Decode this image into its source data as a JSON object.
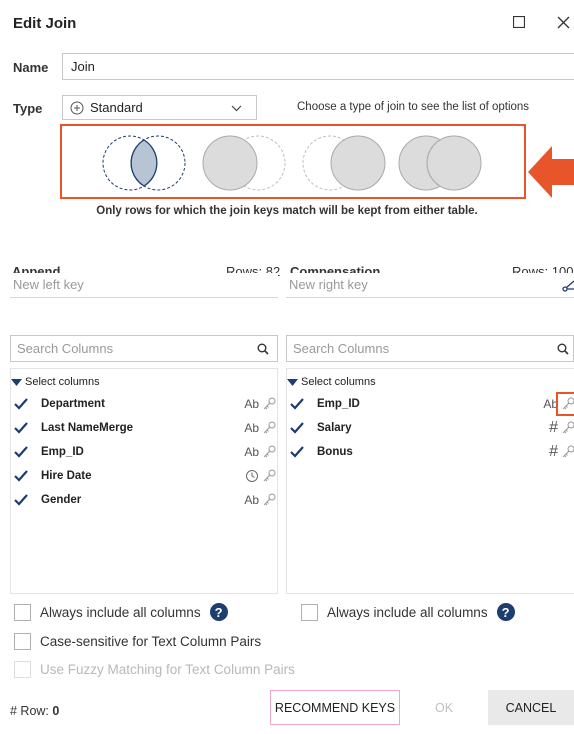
{
  "dialog": {
    "title": "Edit Join"
  },
  "name_field": {
    "label": "Name",
    "value": "Join"
  },
  "type_field": {
    "label": "Type",
    "value": "Standard",
    "hint": "Choose a type of join to see the list of options"
  },
  "join_description": "Only rows for which the join keys match will be kept from either table.",
  "colors": {
    "accent": "#e8552a",
    "check": "#1d3e6e",
    "venn_fill": "#dcdcdc",
    "venn_inner": "#b7c4d3"
  },
  "left": {
    "title": "Append",
    "rows": "Rows: 82",
    "key_placeholder": "New left key",
    "search_placeholder": "Search Columns",
    "select_label": "Select columns",
    "columns": [
      {
        "name": "Department",
        "type": "Ab"
      },
      {
        "name": "Last NameMerge",
        "type": "Ab"
      },
      {
        "name": "Emp_ID",
        "type": "Ab"
      },
      {
        "name": "Hire Date",
        "type": "clock-icon"
      },
      {
        "name": "Gender",
        "type": "Ab"
      }
    ]
  },
  "right": {
    "title": "Compensation",
    "rows": "Rows: 100",
    "key_placeholder": "New right key",
    "search_placeholder": "Search Columns",
    "select_label": "Select columns",
    "columns": [
      {
        "name": "Emp_ID",
        "type": "Ab"
      },
      {
        "name": "Salary",
        "type": "#"
      },
      {
        "name": "Bonus",
        "type": "#"
      }
    ]
  },
  "options": {
    "always_include_left": "Always include all columns",
    "always_include_right": "Always include all columns",
    "case_sensitive": "Case-sensitive for Text Column Pairs",
    "fuzzy": "Use Fuzzy Matching for Text Column Pairs"
  },
  "footer": {
    "row_label": "# Row:",
    "row_count": "0",
    "recommend": "RECOMMEND KEYS",
    "ok": "OK",
    "cancel": "CANCEL"
  }
}
